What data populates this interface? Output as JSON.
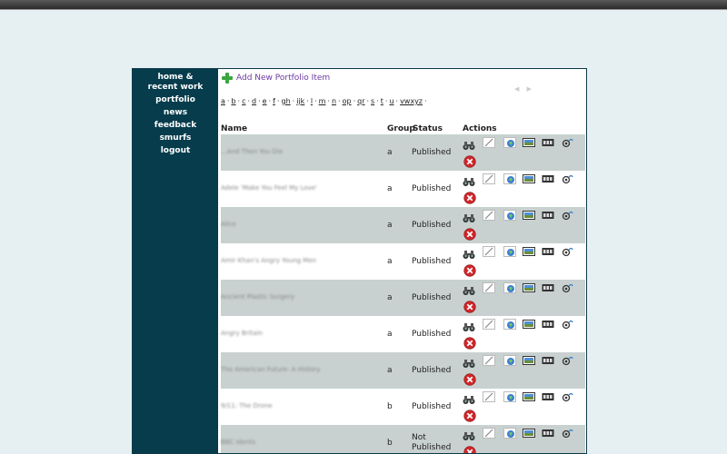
{
  "nav": [
    {
      "label": "home &"
    },
    {
      "label": "recent work"
    },
    {
      "label": "portfolio"
    },
    {
      "label": "news"
    },
    {
      "label": "feedback"
    },
    {
      "label": "smurfs"
    },
    {
      "label": "logout"
    }
  ],
  "add_item_label": "Add New Portfolio Item",
  "letters": [
    "a",
    "b",
    "c",
    "d",
    "e",
    "f",
    "gh",
    "ijk",
    "l",
    "m",
    "n",
    "op",
    "qr",
    "s",
    "t",
    "u",
    "vwxyz"
  ],
  "table": {
    "headers": {
      "name": "Name",
      "group": "Group",
      "status": "Status",
      "actions": "Actions"
    },
    "rows": [
      {
        "name": "...And Then You Die",
        "group": "a",
        "status": "Published"
      },
      {
        "name": "Adele 'Make You Feel My Love'",
        "group": "a",
        "status": "Published"
      },
      {
        "name": "Alice",
        "group": "a",
        "status": "Published"
      },
      {
        "name": "Amir Khan's Angry Young Men",
        "group": "a",
        "status": "Published"
      },
      {
        "name": "Ancient Plastic Surgery",
        "group": "a",
        "status": "Published"
      },
      {
        "name": "Angry Britain",
        "group": "a",
        "status": "Published"
      },
      {
        "name": "The American Future: A History",
        "group": "a",
        "status": "Published"
      },
      {
        "name": "9/11: The Drone",
        "group": "b",
        "status": "Published"
      },
      {
        "name": "BBC Idents",
        "group": "b",
        "status": "Not Published"
      }
    ]
  },
  "icons": [
    "binoculars-icon",
    "edit-pen-icon",
    "globe-icon",
    "image-icon",
    "film-icon",
    "link-icon",
    "delete-icon"
  ],
  "colors": {
    "sidebar": "#063c4c",
    "row_shade": "#c8d1d0",
    "link": "#6b3aa0",
    "delete": "#d0262a"
  }
}
